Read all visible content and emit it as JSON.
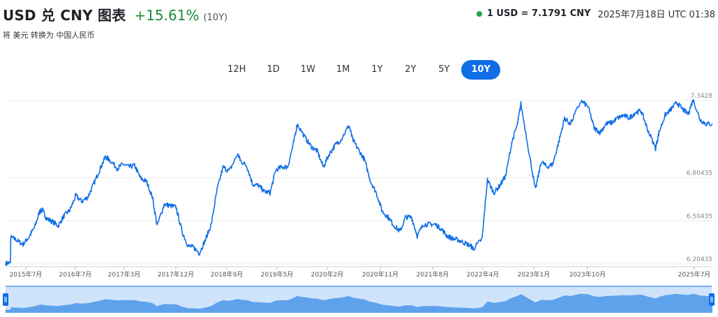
{
  "header": {
    "title": "USD 兑 CNY 图表",
    "change": "+15.61%",
    "period": "(10Y)",
    "subtitle": "将 美元 转换为 中国人民币"
  },
  "rate_box": {
    "rate": "1 USD = 7.1791 CNY",
    "timestamp": "2025年7月18日 UTC 01:38",
    "dot_color": "#22a34a"
  },
  "tabs": [
    {
      "label": "12H",
      "active": false
    },
    {
      "label": "1D",
      "active": false
    },
    {
      "label": "1W",
      "active": false
    },
    {
      "label": "1M",
      "active": false
    },
    {
      "label": "1Y",
      "active": false
    },
    {
      "label": "2Y",
      "active": false
    },
    {
      "label": "5Y",
      "active": false
    },
    {
      "label": "10Y",
      "active": true
    }
  ],
  "colors": {
    "line": "#0f6ee6",
    "positive": "#1b8a3a",
    "accent": "#0f6ee6",
    "navigator_fill": "#5ea2ec",
    "navigator_bg": "#cfe3fb"
  },
  "chart_data": {
    "type": "line",
    "series": [
      {
        "values": [
          [
            "2015-07-18",
            6.21
          ],
          [
            "2015-08-12",
            6.21
          ],
          [
            "2015-08-14",
            6.39
          ],
          [
            "2015-09-15",
            6.37
          ],
          [
            "2015-10-15",
            6.34
          ],
          [
            "2015-11-15",
            6.39
          ],
          [
            "2015-12-15",
            6.46
          ],
          [
            "2016-01-10",
            6.57
          ],
          [
            "2016-01-25",
            6.58
          ],
          [
            "2016-02-15",
            6.52
          ],
          [
            "2016-03-15",
            6.5
          ],
          [
            "2016-04-15",
            6.47
          ],
          [
            "2016-05-15",
            6.54
          ],
          [
            "2016-06-15",
            6.58
          ],
          [
            "2016-07-15",
            6.68
          ],
          [
            "2016-08-15",
            6.64
          ],
          [
            "2016-09-15",
            6.67
          ],
          [
            "2016-10-15",
            6.76
          ],
          [
            "2016-11-15",
            6.86
          ],
          [
            "2016-12-15",
            6.95
          ],
          [
            "2017-01-05",
            6.93
          ],
          [
            "2017-02-15",
            6.87
          ],
          [
            "2017-03-15",
            6.9
          ],
          [
            "2017-04-15",
            6.88
          ],
          [
            "2017-05-15",
            6.89
          ],
          [
            "2017-06-15",
            6.8
          ],
          [
            "2017-07-15",
            6.78
          ],
          [
            "2017-08-15",
            6.67
          ],
          [
            "2017-09-08",
            6.47
          ],
          [
            "2017-10-15",
            6.62
          ],
          [
            "2017-11-15",
            6.61
          ],
          [
            "2017-12-15",
            6.6
          ],
          [
            "2018-01-15",
            6.43
          ],
          [
            "2018-02-15",
            6.33
          ],
          [
            "2018-03-15",
            6.32
          ],
          [
            "2018-04-15",
            6.28
          ],
          [
            "2018-05-15",
            6.37
          ],
          [
            "2018-06-15",
            6.48
          ],
          [
            "2018-07-15",
            6.72
          ],
          [
            "2018-08-15",
            6.88
          ],
          [
            "2018-09-15",
            6.85
          ],
          [
            "2018-10-30",
            6.97
          ],
          [
            "2018-11-15",
            6.92
          ],
          [
            "2018-12-15",
            6.89
          ],
          [
            "2019-01-15",
            6.76
          ],
          [
            "2019-02-15",
            6.75
          ],
          [
            "2019-03-15",
            6.71
          ],
          [
            "2019-04-15",
            6.7
          ],
          [
            "2019-05-15",
            6.86
          ],
          [
            "2019-06-15",
            6.88
          ],
          [
            "2019-07-15",
            6.88
          ],
          [
            "2019-08-15",
            7.05
          ],
          [
            "2019-09-02",
            7.18
          ],
          [
            "2019-10-15",
            7.08
          ],
          [
            "2019-11-15",
            7.02
          ],
          [
            "2019-12-15",
            6.99
          ],
          [
            "2020-01-15",
            6.88
          ],
          [
            "2020-02-15",
            6.97
          ],
          [
            "2020-03-15",
            7.03
          ],
          [
            "2020-04-15",
            7.07
          ],
          [
            "2020-05-27",
            7.17
          ],
          [
            "2020-06-15",
            7.07
          ],
          [
            "2020-07-15",
            7.0
          ],
          [
            "2020-08-15",
            6.93
          ],
          [
            "2020-09-15",
            6.78
          ],
          [
            "2020-10-15",
            6.7
          ],
          [
            "2020-11-15",
            6.57
          ],
          [
            "2020-12-15",
            6.53
          ],
          [
            "2021-01-15",
            6.47
          ],
          [
            "2021-02-15",
            6.43
          ],
          [
            "2021-03-15",
            6.53
          ],
          [
            "2021-04-15",
            6.53
          ],
          [
            "2021-05-15",
            6.4
          ],
          [
            "2021-06-15",
            6.48
          ],
          [
            "2021-07-15",
            6.48
          ],
          [
            "2021-08-15",
            6.48
          ],
          [
            "2021-09-15",
            6.45
          ],
          [
            "2021-10-15",
            6.4
          ],
          [
            "2021-11-15",
            6.38
          ],
          [
            "2021-12-15",
            6.37
          ],
          [
            "2022-01-15",
            6.35
          ],
          [
            "2022-02-15",
            6.33
          ],
          [
            "2022-03-01",
            6.31
          ],
          [
            "2022-04-15",
            6.38
          ],
          [
            "2022-05-12",
            6.79
          ],
          [
            "2022-06-15",
            6.7
          ],
          [
            "2022-07-15",
            6.75
          ],
          [
            "2022-08-15",
            6.82
          ],
          [
            "2022-09-15",
            7.05
          ],
          [
            "2022-10-15",
            7.18
          ],
          [
            "2022-11-01",
            7.32
          ],
          [
            "2022-12-15",
            6.97
          ],
          [
            "2023-01-15",
            6.72
          ],
          [
            "2023-02-15",
            6.92
          ],
          [
            "2023-03-15",
            6.88
          ],
          [
            "2023-04-15",
            6.9
          ],
          [
            "2023-05-15",
            7.05
          ],
          [
            "2023-06-15",
            7.22
          ],
          [
            "2023-07-15",
            7.18
          ],
          [
            "2023-09-08",
            7.34
          ],
          [
            "2023-10-15",
            7.3
          ],
          [
            "2023-11-15",
            7.15
          ],
          [
            "2023-12-15",
            7.12
          ],
          [
            "2024-01-15",
            7.18
          ],
          [
            "2024-02-15",
            7.19
          ],
          [
            "2024-03-15",
            7.22
          ],
          [
            "2024-04-15",
            7.24
          ],
          [
            "2024-05-15",
            7.22
          ],
          [
            "2024-06-15",
            7.26
          ],
          [
            "2024-07-15",
            7.27
          ],
          [
            "2024-08-15",
            7.15
          ],
          [
            "2024-09-27",
            7.01
          ],
          [
            "2024-10-15",
            7.12
          ],
          [
            "2024-11-15",
            7.24
          ],
          [
            "2024-12-15",
            7.28
          ],
          [
            "2025-01-15",
            7.33
          ],
          [
            "2025-02-15",
            7.28
          ],
          [
            "2025-03-15",
            7.25
          ],
          [
            "2025-04-09",
            7.35
          ],
          [
            "2025-05-15",
            7.21
          ],
          [
            "2025-06-15",
            7.18
          ],
          [
            "2025-07-18",
            7.18
          ]
        ]
      }
    ],
    "x_ticks": [
      "2015年7月",
      "2016年7月",
      "2017年3月",
      "2017年12月",
      "2018年9月",
      "2019年5月",
      "2020年2月",
      "2020年11月",
      "2021年8月",
      "2022年4月",
      "2023年1月",
      "2023年10月",
      "2025年7月"
    ],
    "y_ticks": [
      "6.20435",
      "6.50435",
      "6.80435",
      "7.3428"
    ],
    "ylim": [
      6.20435,
      7.3428
    ],
    "xlabel": "",
    "ylabel": "",
    "grid": true,
    "legend": "none"
  }
}
